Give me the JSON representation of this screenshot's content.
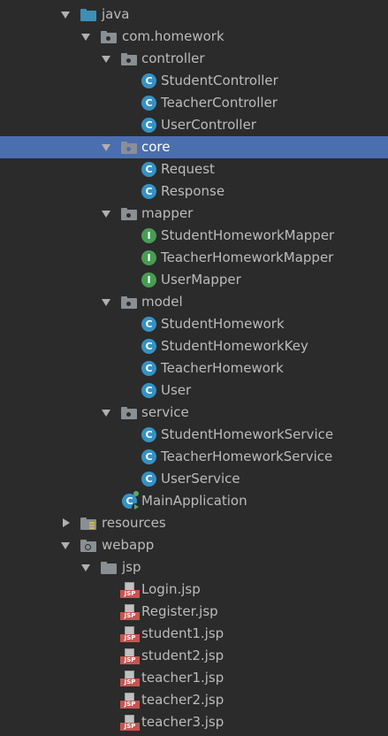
{
  "tree": {
    "java": {
      "label": "java"
    },
    "com_homework": {
      "label": "com.homework"
    },
    "controller": {
      "label": "controller",
      "items": [
        "StudentController",
        "TeacherController",
        "UserController"
      ]
    },
    "core": {
      "label": "core",
      "items": [
        "Request",
        "Response"
      ]
    },
    "mapper": {
      "label": "mapper",
      "items": [
        "StudentHomeworkMapper",
        "TeacherHomeworkMapper",
        "UserMapper"
      ]
    },
    "model": {
      "label": "model",
      "items": [
        "StudentHomework",
        "StudentHomeworkKey",
        "TeacherHomework",
        "User"
      ]
    },
    "service": {
      "label": "service",
      "items": [
        "StudentHomeworkService",
        "TeacherHomeworkService",
        "UserService"
      ]
    },
    "main_app": {
      "label": "MainApplication"
    },
    "resources": {
      "label": "resources"
    },
    "webapp": {
      "label": "webapp"
    },
    "jsp": {
      "label": "jsp",
      "items": [
        "Login.jsp",
        "Register.jsp",
        "student1.jsp",
        "student2.jsp",
        "teacher1.jsp",
        "teacher2.jsp",
        "teacher3.jsp"
      ]
    }
  },
  "icons": {
    "class_glyph": "C",
    "interface_glyph": "I",
    "jsp_badge": "JSP"
  },
  "colors": {
    "background": "#2b2b2b",
    "selection": "#4b6eaf",
    "text": "#bbbbbb",
    "class_icon": "#3592c4",
    "interface_icon": "#499c54",
    "jsp_icon": "#c75450",
    "source_folder": "#3d8fb7"
  }
}
